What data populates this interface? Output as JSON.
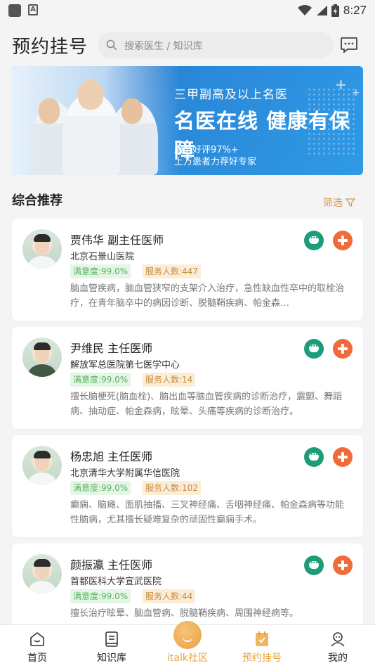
{
  "status_bar": {
    "time": "8:27"
  },
  "header": {
    "title": "预约挂号",
    "search_placeholder": "搜索医生 / 知识库"
  },
  "banner": {
    "line1": "三甲副高及以上名医",
    "line2": "名医在线 健康有保障",
    "line3": "服务好评97%+",
    "line4": "上万患者力荐好专家"
  },
  "section": {
    "title": "综合推荐",
    "filter_label": "筛选"
  },
  "doctors": [
    {
      "name_title": "贾伟华 副主任医师",
      "hospital": "北京石景山医院",
      "satisfaction": "满意度:99.0%",
      "served": "服务人数:447",
      "description": "脑血管疾病，脑血管狭窄的支架介入治疗，急性缺血性卒中的取栓治疗，在青年脑卒中的病因诊断、脱髓鞘疾病、帕金森…"
    },
    {
      "name_title": "尹维民 主任医师",
      "hospital": "解放军总医院第七医学中心",
      "satisfaction": "满意度:99.0%",
      "served": "服务人数:14",
      "description": "擅长脑梗死(脑血栓)、脑出血等脑血管疾病的诊断治疗，震颤、舞蹈病、抽动症、帕金森病，眩晕、头痛等疾病的诊断治疗。"
    },
    {
      "name_title": "杨忠旭 主任医师",
      "hospital": "北京清华大学附属华信医院",
      "satisfaction": "满意度:99.0%",
      "served": "服务人数:102",
      "description": "癫痫、脑瘫、面肌抽搐、三叉神经痛、舌咽神经痛、帕金森病等功能性脑病，尤其擅长疑难复杂的顽固性癫痫手术。"
    },
    {
      "name_title": "颜振瀛 主任医师",
      "hospital": "首都医科大学宣武医院",
      "satisfaction": "满意度:99.0%",
      "served": "服务人数:44",
      "description": "擅长治疗眩晕、脑血管病、脱髓鞘疾病、周围神经病等。"
    }
  ],
  "tabs": [
    {
      "label": "首页",
      "icon": "home-icon"
    },
    {
      "label": "知识库",
      "icon": "book-icon"
    },
    {
      "label": "italk社区",
      "icon": "community-icon"
    },
    {
      "label": "预约挂号",
      "icon": "appointment-icon"
    },
    {
      "label": "我的",
      "icon": "profile-icon"
    }
  ],
  "colors": {
    "accent": "#e6a13c",
    "chat": "#1d9c7a",
    "plus": "#f06a3a"
  }
}
